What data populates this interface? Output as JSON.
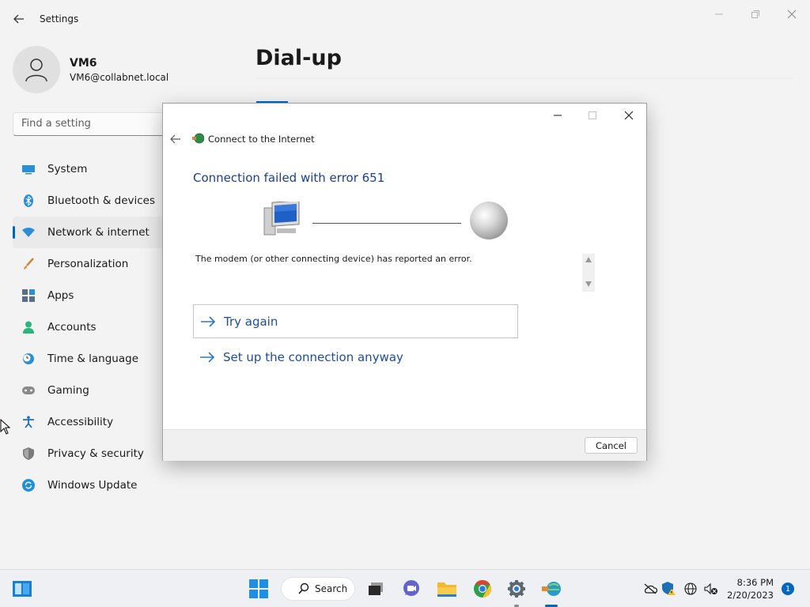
{
  "window": {
    "title": "Settings"
  },
  "profile": {
    "name": "VM6",
    "email": "VM6@collabnet.local"
  },
  "search": {
    "placeholder": "Find a setting"
  },
  "nav": {
    "items": [
      {
        "label": "System",
        "icon": "monitor-icon"
      },
      {
        "label": "Bluetooth & devices",
        "icon": "bluetooth-icon"
      },
      {
        "label": "Network & internet",
        "icon": "wifi-icon",
        "selected": true
      },
      {
        "label": "Personalization",
        "icon": "brush-icon"
      },
      {
        "label": "Apps",
        "icon": "apps-icon"
      },
      {
        "label": "Accounts",
        "icon": "person-icon"
      },
      {
        "label": "Time & language",
        "icon": "clock-globe-icon"
      },
      {
        "label": "Gaming",
        "icon": "gamepad-icon"
      },
      {
        "label": "Accessibility",
        "icon": "accessibility-icon"
      },
      {
        "label": "Privacy & security",
        "icon": "shield-icon"
      },
      {
        "label": "Windows Update",
        "icon": "update-icon"
      }
    ]
  },
  "page": {
    "title": "Dial-up"
  },
  "dialog": {
    "title": "Connect to the Internet",
    "heading": "Connection failed with error 651",
    "message": "The modem (or other connecting device) has reported an error.",
    "options": [
      {
        "label": "Try again"
      },
      {
        "label": "Set up the connection anyway"
      }
    ],
    "cancel_label": "Cancel"
  },
  "taskbar": {
    "search_label": "Search",
    "clock": {
      "time": "8:36 PM",
      "date": "2/20/2023"
    },
    "notification_count": "1"
  },
  "colors": {
    "accent": "#0067c0",
    "link": "#1c4e9c",
    "heading": "#1b3f91"
  }
}
